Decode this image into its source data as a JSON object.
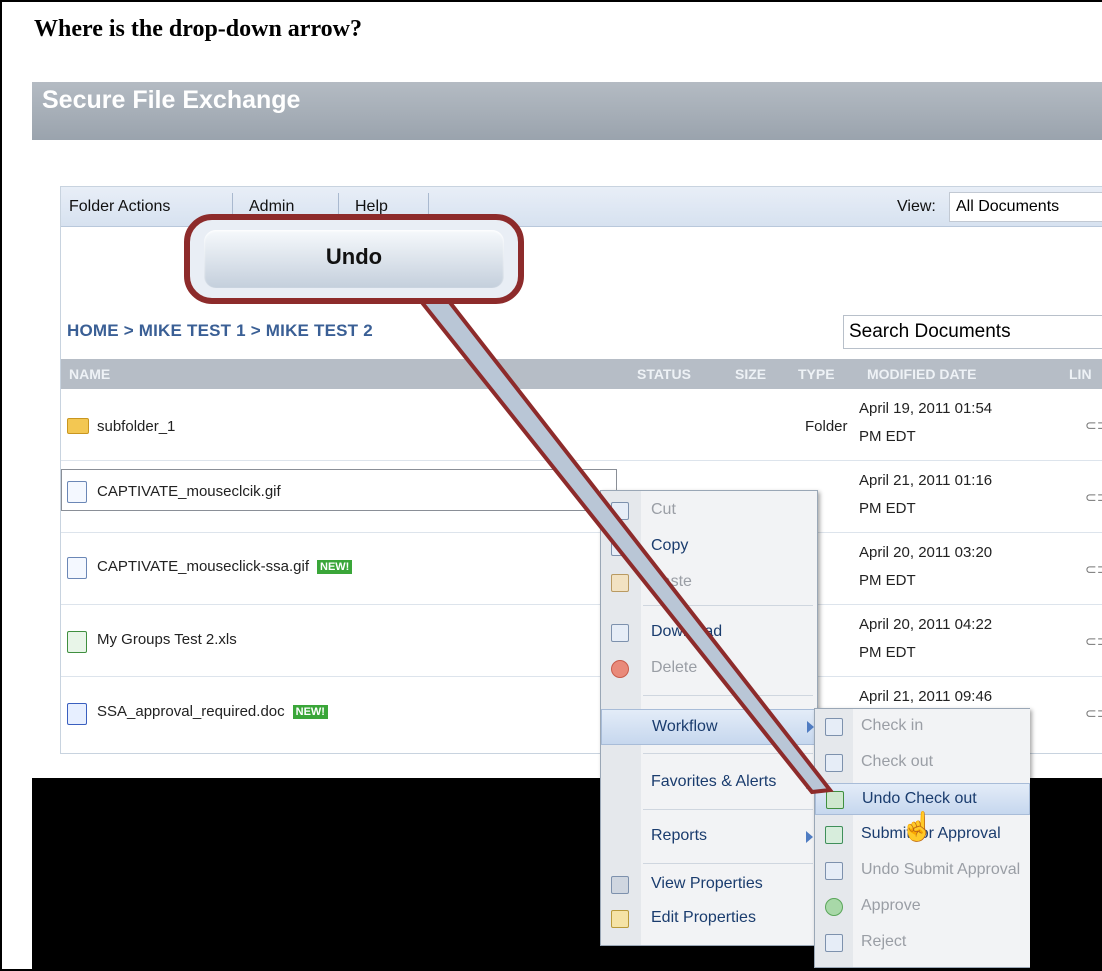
{
  "question": "Where is the drop-down arrow?",
  "app": {
    "title": "Secure File Exchange"
  },
  "toolbar": {
    "folder_actions": "Folder Actions",
    "admin": "Admin",
    "help": "Help",
    "view_label": "View:",
    "view_value": "All Documents"
  },
  "breadcrumb": "HOME  >  MIKE TEST 1  >  MIKE TEST 2",
  "search": {
    "placeholder": "Search Documents"
  },
  "columns": {
    "name": "NAME",
    "status": "STATUS",
    "size": "SIZE",
    "type": "TYPE",
    "modified": "MODIFIED DATE",
    "link": "LIN"
  },
  "files": [
    {
      "name": "subfolder_1",
      "type": "Folder",
      "date1": "April 19, 2011 01:54",
      "date2": "PM EDT",
      "kind": "folder"
    },
    {
      "name": "CAPTIVATE_mouseclcik.gif",
      "type": "",
      "date1": "April 21, 2011 01:16",
      "date2": "PM EDT",
      "kind": "file"
    },
    {
      "name": "CAPTIVATE_mouseclick-ssa.gif",
      "badge": "NEW!",
      "type": "",
      "date1": "April 20, 2011 03:20",
      "date2": "PM EDT",
      "kind": "file"
    },
    {
      "name": "My Groups Test 2.xls",
      "type": "",
      "date1": "April 20, 2011 04:22",
      "date2": "PM EDT",
      "kind": "xls"
    },
    {
      "name": "SSA_approval_required.doc",
      "badge": "NEW!",
      "type": "",
      "date1": "April 21, 2011 09:46",
      "date2": "",
      "kind": "doc"
    }
  ],
  "context_menu": {
    "cut": "Cut",
    "copy": "Copy",
    "paste": "Paste",
    "download": "Download",
    "delete": "Delete",
    "workflow": "Workflow",
    "favorites": "Favorites & Alerts",
    "reports": "Reports",
    "view_properties": "View Properties",
    "edit_properties": "Edit Properties"
  },
  "workflow_menu": {
    "check_in": "Check in",
    "check_out": "Check out",
    "undo_check_out": "Undo Check out",
    "submit_for_approval": "Submit for Approval",
    "undo_submit": "Undo Submit Approval",
    "approve": "Approve",
    "reject": "Reject"
  },
  "callout": {
    "text": "Undo"
  },
  "colors": {
    "accent": "#3a5f95",
    "callout_border": "#8d2b2b",
    "new_badge": "#3aa639"
  }
}
